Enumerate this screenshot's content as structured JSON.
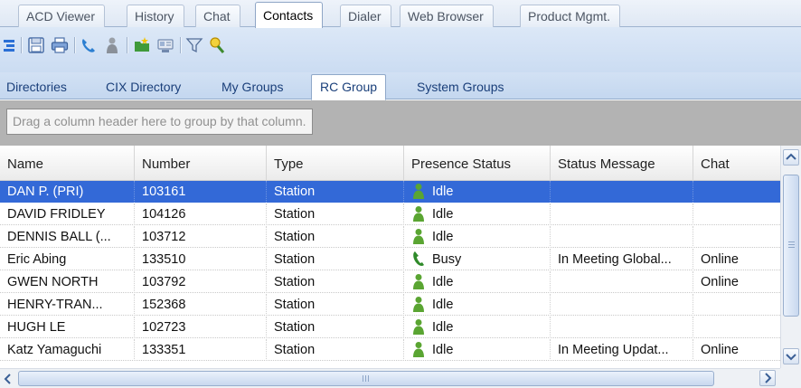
{
  "top_tabs": [
    {
      "label": "ACD Viewer"
    },
    {
      "label": "History"
    },
    {
      "label": "Chat"
    },
    {
      "label": "Contacts",
      "active": true
    },
    {
      "label": "Dialer"
    },
    {
      "label": "Web Browser"
    },
    {
      "label": "Product Mgmt."
    }
  ],
  "toolbar": {
    "icons": [
      "expand-icon",
      "save-icon",
      "print-icon",
      "phone-icon",
      "person-icon",
      "new-folder-icon",
      "card-icon",
      "filter-icon",
      "search-person-icon"
    ]
  },
  "sub_tabs": [
    {
      "label": "Directories"
    },
    {
      "label": "CIX Directory"
    },
    {
      "label": "My Groups"
    },
    {
      "label": "RC Group",
      "active": true
    },
    {
      "label": "System Groups"
    }
  ],
  "group_panel": {
    "hint": "Drag a column header here to group by that column."
  },
  "grid": {
    "columns": [
      "Name",
      "Number",
      "Type",
      "Presence Status",
      "Status Message",
      "Chat"
    ],
    "rows": [
      {
        "name": "DAN P. (PRI)",
        "number": "103161",
        "type": "Station",
        "presence": "Idle",
        "presence_icon": "person-idle-icon",
        "message": "",
        "chat": "",
        "selected": true
      },
      {
        "name": "DAVID FRIDLEY",
        "number": "104126",
        "type": "Station",
        "presence": "Idle",
        "presence_icon": "person-idle-icon",
        "message": "",
        "chat": ""
      },
      {
        "name": "DENNIS BALL (...",
        "number": "103712",
        "type": "Station",
        "presence": "Idle",
        "presence_icon": "person-idle-icon",
        "message": "",
        "chat": ""
      },
      {
        "name": "Eric Abing",
        "number": "133510",
        "type": "Station",
        "presence": "Busy",
        "presence_icon": "phone-busy-icon",
        "message": "In Meeting Global...",
        "chat": "Online"
      },
      {
        "name": "GWEN NORTH",
        "number": "103792",
        "type": "Station",
        "presence": "Idle",
        "presence_icon": "person-idle-icon",
        "message": "",
        "chat": "Online"
      },
      {
        "name": "HENRY-TRAN...",
        "number": "152368",
        "type": "Station",
        "presence": "Idle",
        "presence_icon": "person-idle-icon",
        "message": "",
        "chat": ""
      },
      {
        "name": "HUGH LE",
        "number": "102723",
        "type": "Station",
        "presence": "Idle",
        "presence_icon": "person-idle-icon",
        "message": "",
        "chat": ""
      },
      {
        "name": "Katz Yamaguchi",
        "number": "133351",
        "type": "Station",
        "presence": "Idle",
        "presence_icon": "person-idle-icon",
        "message": "In Meeting Updat...",
        "chat": "Online"
      }
    ]
  },
  "colors": {
    "selection": "#3369d7",
    "toolbar_bg": "#cbdcf2",
    "group_panel_bg": "#b3b3b3",
    "idle_green": "#5aa532",
    "busy_green": "#2f8a2a"
  }
}
